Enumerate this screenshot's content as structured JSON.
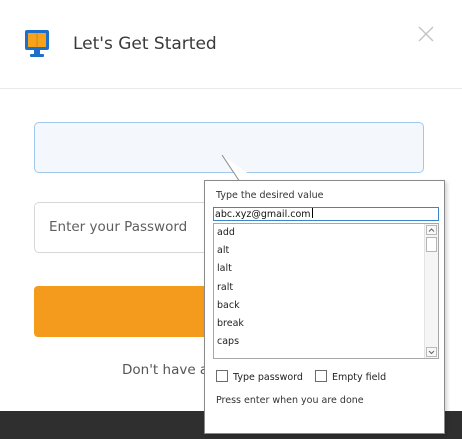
{
  "dialog": {
    "title": "Let's Get Started",
    "icon": "monitor-book-icon",
    "close_icon": "close-icon"
  },
  "form": {
    "email_value": "",
    "password_placeholder": "Enter your Password",
    "submit_label": "",
    "signup_text": "Don't have a"
  },
  "value_picker": {
    "heading": "Type the desired value",
    "input_value": "abc.xyz@gmail.com",
    "options": [
      "add",
      "alt",
      "lalt",
      "ralt",
      "back",
      "break",
      "caps"
    ],
    "scroll_up_icon": "arrow-up-icon",
    "scroll_down_icon": "arrow-down-icon",
    "type_password_label": "Type password",
    "type_password_checked": false,
    "empty_field_label": "Empty field",
    "empty_field_checked": false,
    "hint": "Press enter when you are done"
  },
  "colors": {
    "accent_orange": "#f49a1c",
    "input_focus_border": "#9fc8ec",
    "footer": "#2f2f2f",
    "icon_blue": "#1e6fc7",
    "icon_orange": "#f7a21b"
  }
}
